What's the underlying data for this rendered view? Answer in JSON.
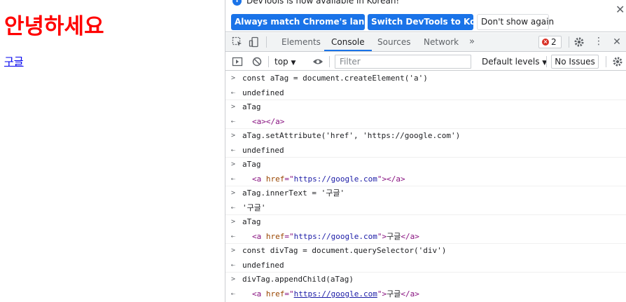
{
  "page": {
    "heading": "안녕하세요",
    "link_text": "구글"
  },
  "devtools": {
    "infobar": {
      "message": "DevTools is now available in Korean!",
      "match_button": "Always match Chrome's language",
      "switch_button": "Switch DevTools to Korean",
      "dismiss_button": "Don't show again"
    },
    "tabs": [
      {
        "label": "Elements"
      },
      {
        "label": "Console"
      },
      {
        "label": "Sources"
      },
      {
        "label": "Network"
      }
    ],
    "error_count": "2",
    "console_toolbar": {
      "context": "top",
      "filter_placeholder": "Filter",
      "levels": "Default levels",
      "issues": "No Issues"
    },
    "console": {
      "r1_in": "const aTag = document.createElement('a')",
      "r1_out": "undefined",
      "r2_in": "aTag",
      "r3_in": "aTag.setAttribute('href', 'https://google.com')",
      "r3_out": "undefined",
      "r4_in": "aTag",
      "r5_in": "aTag.innerText = '구글'",
      "r5_out": "'구글'",
      "r6_in": "aTag",
      "r7_in": "const divTag = document.querySelector('div')",
      "r7_out": "undefined",
      "r8_in": "divTag.appendChild(aTag)",
      "href": "https://google.com",
      "link_text": "구글"
    },
    "colors": {
      "accent": "#1a73e8",
      "heading": "#ff0000",
      "string": "#c41a16",
      "tag": "#881280",
      "attr": "#994500",
      "attr_value": "#1a1aa6"
    }
  }
}
